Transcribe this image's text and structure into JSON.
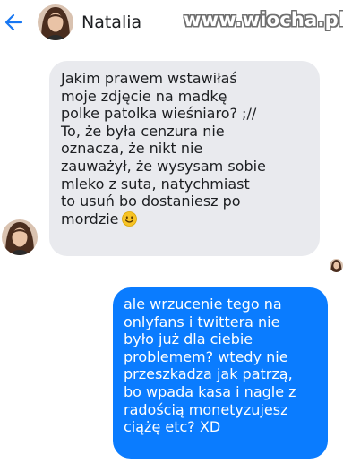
{
  "header": {
    "back_icon": "back-arrow-icon",
    "contact_name": "Natalia",
    "watermark": "www.wiocha.pl"
  },
  "messages": {
    "incoming": {
      "lines": [
        "Jakim prawem wstawiłaś",
        "moje zdjęcie na madkę",
        "polke patolka wieśniaro? ;//",
        "To, że była cenzura nie",
        "oznacza, że nikt nie",
        "zauważył, że wysysam sobie",
        "mleko z suta, natychmiast",
        "to usuń bo dostaniesz po",
        "mordzie"
      ],
      "emoji": "smiling-face-emoji"
    },
    "outgoing": {
      "lines": [
        "ale wrzucenie tego na",
        "onlyfans i twittera nie",
        "było już dla ciebie",
        "problemem? wtedy nie",
        "przeszkadza jak patrzą,",
        "bo wpada kasa i nagle z",
        "radością monetyzujesz",
        "ciążę etc? XD"
      ]
    }
  },
  "colors": {
    "accent": "#1877f2",
    "incoming_bubble": "#e9eaee",
    "outgoing_bubble": "#0a7cff",
    "background": "#ffffff"
  }
}
